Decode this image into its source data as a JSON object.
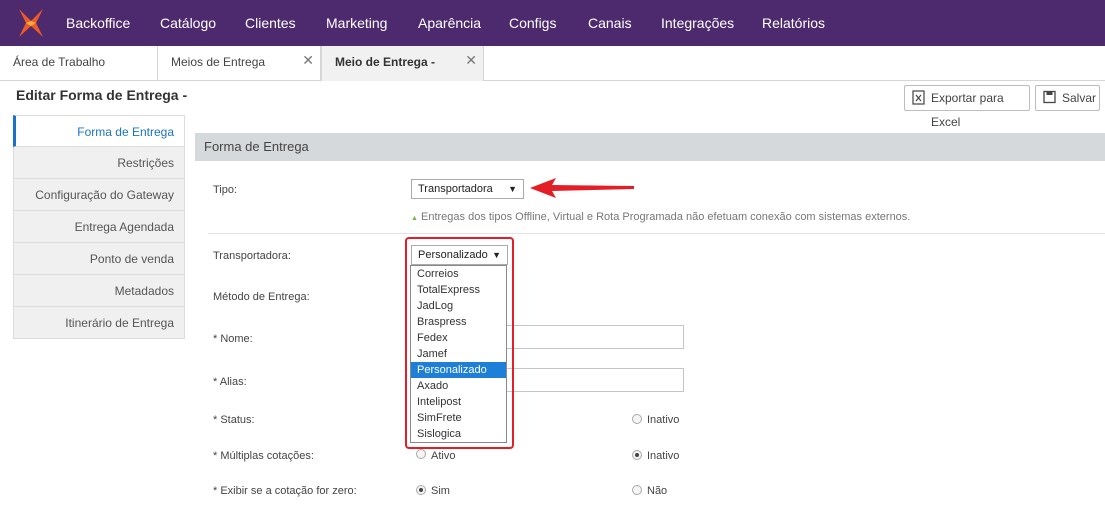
{
  "nav": {
    "items": [
      "Backoffice",
      "Catálogo",
      "Clientes",
      "Marketing",
      "Aparência",
      "Configs",
      "Canais",
      "Integrações",
      "Relatórios"
    ]
  },
  "tabs": [
    {
      "label": "Área de Trabalho"
    },
    {
      "label": "Meios de Entrega",
      "close": "✕"
    },
    {
      "label": "Meio de Entrega -",
      "close": "✕"
    }
  ],
  "page": {
    "title": "Editar Forma de Entrega -"
  },
  "toolbar": {
    "export_label": "Exportar para Excel",
    "save_label": "Salvar"
  },
  "sidebar": {
    "items": [
      {
        "label": "Forma de Entrega"
      },
      {
        "label": "Restrições"
      },
      {
        "label": "Configuração do Gateway"
      },
      {
        "label": "Entrega Agendada"
      },
      {
        "label": "Ponto de venda"
      },
      {
        "label": "Metadados"
      },
      {
        "label": "Itinerário de Entrega"
      }
    ]
  },
  "form": {
    "section_title": "Forma de Entrega",
    "tipo": {
      "label": "Tipo:",
      "value": "Transportadora",
      "hint": "Entregas dos tipos Offline, Virtual e Rota Programada não efetuam conexão com sistemas externos."
    },
    "transportadora": {
      "label": "Transportadora:",
      "value": "Personalizado"
    },
    "metodo": {
      "label": "Método de Entrega:"
    },
    "nome": {
      "label": "* Nome:"
    },
    "alias": {
      "label": "* Alias:"
    },
    "status": {
      "label": "* Status:",
      "opt2": "Inativo"
    },
    "multiplas": {
      "label": "* Múltiplas cotações:",
      "opt1": "Ativo",
      "opt2": "Inativo"
    },
    "exibir": {
      "label": "* Exibir se a cotação for zero:",
      "opt1": "Sim",
      "opt2": "Não"
    }
  },
  "dropdown": {
    "options": [
      "Correios",
      "TotalExpress",
      "JadLog",
      "Braspress",
      "Fedex",
      "Jamef",
      "Personalizado",
      "Axado",
      "Intelipost",
      "SimFrete",
      "Sislogica"
    ],
    "selected_index": 6
  },
  "colors": {
    "topbar": "#4d2a6e",
    "accent": "#1a73c9",
    "annotation": "#e41e26",
    "selected": "#1e7fd9"
  }
}
